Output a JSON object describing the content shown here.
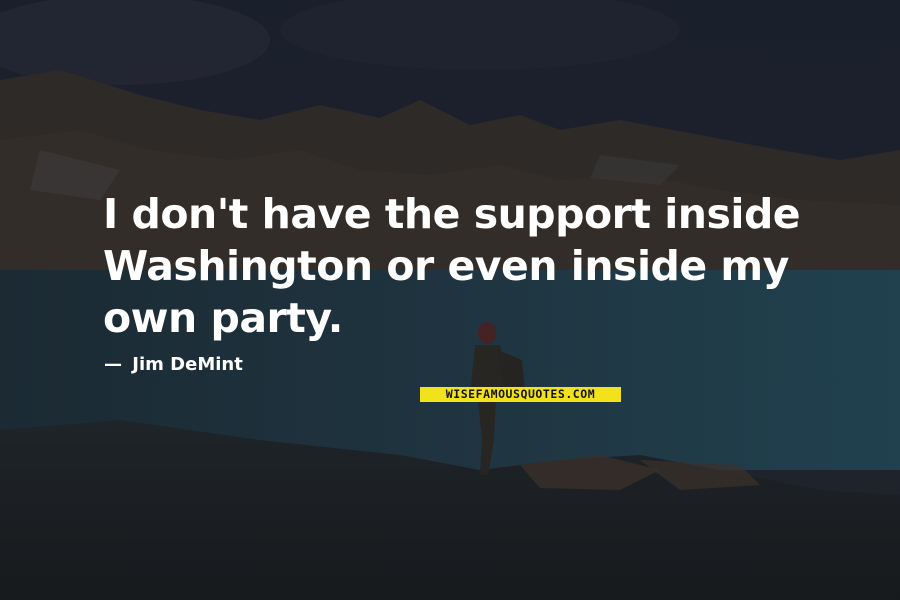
{
  "quote": {
    "lines": [
      "I don't have the support inside",
      "Washington or even inside my",
      "own party."
    ]
  },
  "author": {
    "prefix": "—",
    "name": "Jim DeMint"
  },
  "watermark": {
    "text": "WISEFAMOUSQUOTES.COM"
  },
  "colors": {
    "text": "#ffffff",
    "watermark_bg": "#f2e21c",
    "watermark_text": "#151515"
  }
}
